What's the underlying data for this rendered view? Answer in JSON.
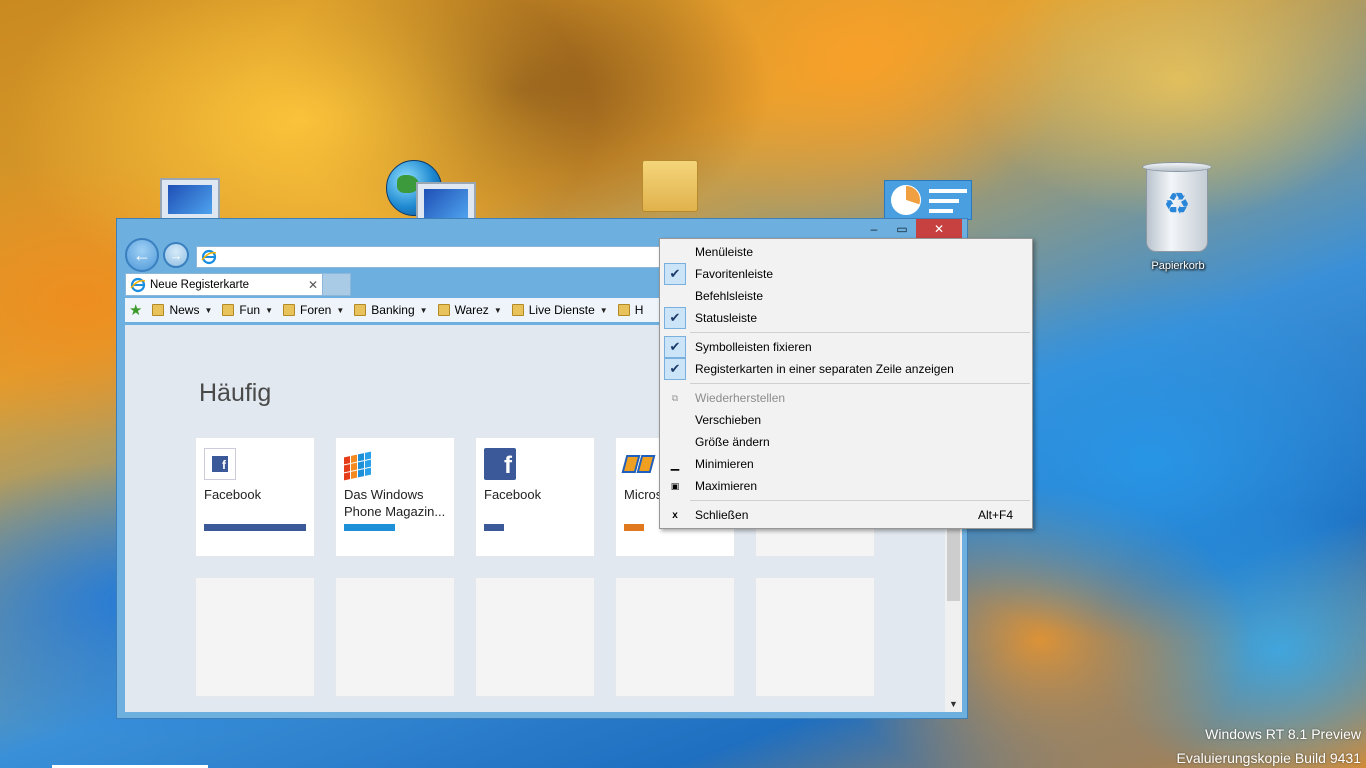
{
  "desktop": {
    "recycle_bin_label": "Papierkorb",
    "watermark_line1": "Windows RT 8.1 Preview",
    "watermark_line2": "Evaluierungskopie Build 9431"
  },
  "browser": {
    "address_value": "",
    "tab_title": "Neue Registerkarte",
    "favorites": [
      {
        "label": "News",
        "dropdown": true
      },
      {
        "label": "Fun",
        "dropdown": true
      },
      {
        "label": "Foren",
        "dropdown": true
      },
      {
        "label": "Banking",
        "dropdown": true
      },
      {
        "label": "Warez",
        "dropdown": true
      },
      {
        "label": "Live Dienste",
        "dropdown": true
      },
      {
        "label": "H",
        "dropdown": false
      }
    ],
    "section_heading": "Häufig",
    "tiles": [
      {
        "name": "Facebook",
        "icon": "facebook-icon",
        "bar_color": "#3b5998",
        "usage": 1.0
      },
      {
        "name": "Das Windows Phone Magazin...",
        "icon": "windows-phone-icon",
        "bar_color": "#1e90d8",
        "usage": 0.5
      },
      {
        "name": "Facebook",
        "icon": "facebook-icon",
        "bar_color": "#3b5998",
        "usage": 0.2
      },
      {
        "name": "Micros Surfac",
        "icon": "app-icon",
        "bar_color": "#e07820",
        "usage": 0.2
      }
    ]
  },
  "context_menu": {
    "items": [
      {
        "label": "Menüleiste",
        "checked": false
      },
      {
        "label": "Favoritenleiste",
        "checked": true
      },
      {
        "label": "Befehlsleiste",
        "checked": false
      },
      {
        "label": "Statusleiste",
        "checked": true
      },
      {
        "label": "Symbolleisten fixieren",
        "checked": true
      },
      {
        "label": "Registerkarten in einer separaten Zeile anzeigen",
        "checked": true
      },
      {
        "label": "Wiederherstellen",
        "disabled": true,
        "icon": "restore-icon"
      },
      {
        "label": "Verschieben"
      },
      {
        "label": "Größe ändern"
      },
      {
        "label": "Minimieren",
        "icon": "minimize-icon"
      },
      {
        "label": "Maximieren",
        "icon": "maximize-icon"
      },
      {
        "label": "Schließen",
        "icon": "close-icon",
        "accelerator": "Alt+F4"
      }
    ]
  },
  "colors": {
    "close_button": "#c74141",
    "window_frame": "#6db0df",
    "check_highlight": "#cce4f7"
  }
}
